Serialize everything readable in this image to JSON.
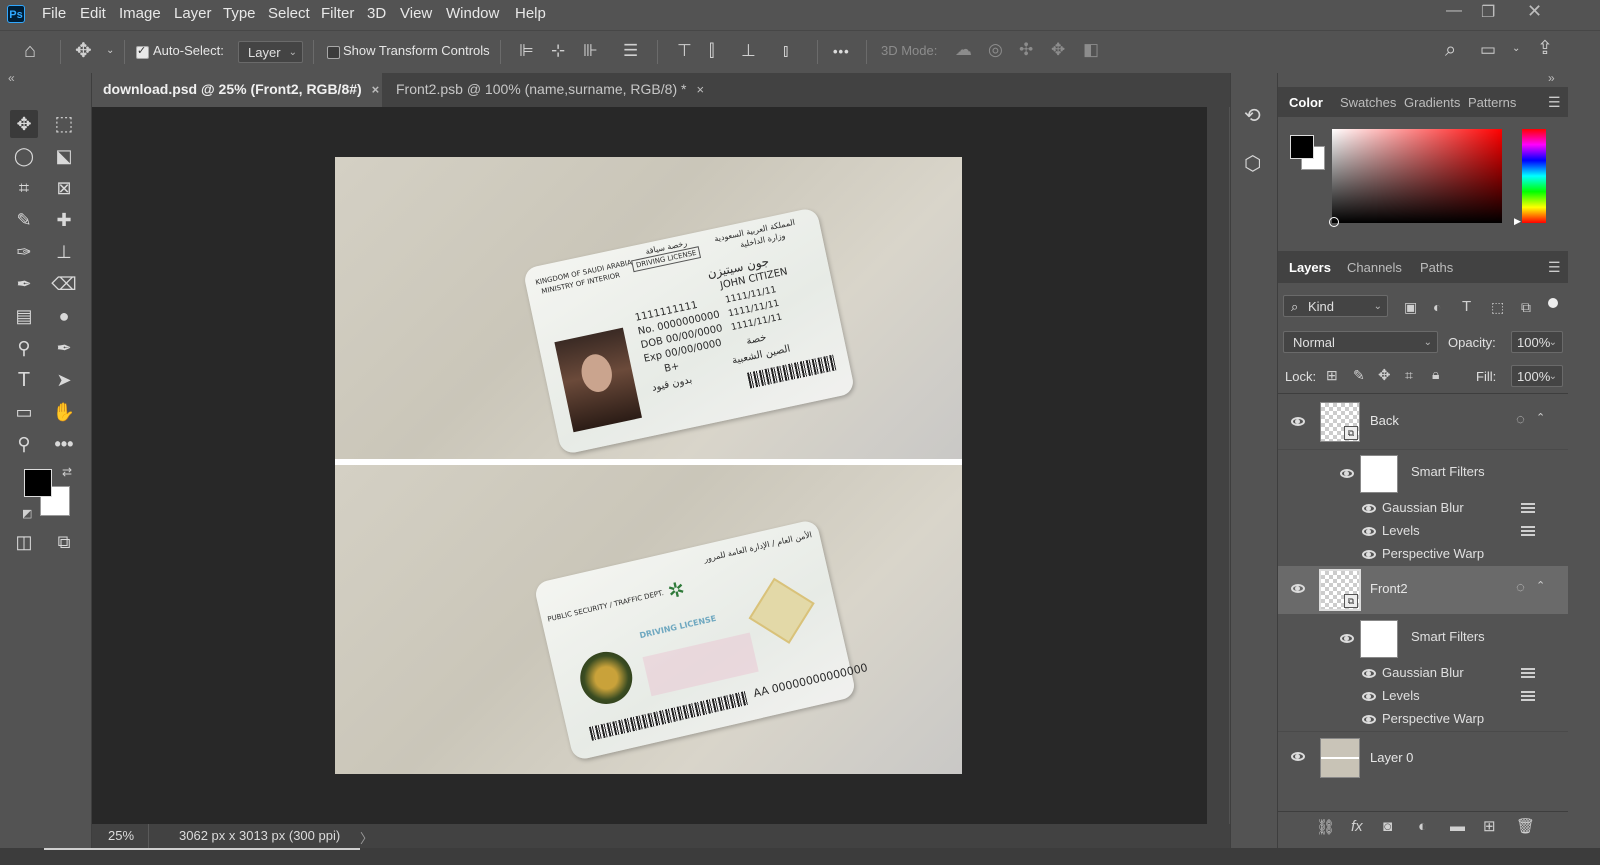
{
  "app": {
    "logo": "Ps"
  },
  "menu": [
    "File",
    "Edit",
    "Image",
    "Layer",
    "Type",
    "Select",
    "Filter",
    "3D",
    "View",
    "Window",
    "Help"
  ],
  "window_controls": {
    "minimize": "—",
    "restore": "❐",
    "close": "✕"
  },
  "options_bar": {
    "auto_select_label": "Auto-Select:",
    "auto_select_checked": true,
    "auto_select_target": "Layer",
    "show_transform_label": "Show Transform Controls",
    "show_transform_checked": false,
    "more_label": "•••",
    "mode_3d_label": "3D Mode:"
  },
  "tabs": [
    {
      "title": "download.psd @ 25% (Front2, RGB/8#)",
      "close": "×",
      "active": true
    },
    {
      "title": "Front2.psb @ 100% (name,surname, RGB/8) *",
      "close": "×",
      "active": false
    }
  ],
  "status": {
    "zoom": "25%",
    "doc_info": "3062 px x 3013 px (300 ppi)",
    "arrow": "〉"
  },
  "card_front": {
    "line1": "KINGDOM OF SAUDI ARABIA",
    "line2": "MINISTRY OF INTERIOR",
    "dl_label": "DRIVING LICENSE",
    "ar_kingdom": "المملكة العربية السعودية",
    "ar_ministry": "وزارة الداخلية",
    "ar_dl": "رخصة سياقة",
    "ar_name": "جون سيتيزن",
    "name": "JOHN CITIZEN",
    "id": "1111111111",
    "no": "No. 0000000000",
    "dob": "DOB  00/00/0000",
    "exp": "Exp  00/00/0000",
    "blood": "B+",
    "dates": "1111/11/11",
    "ar_type": "خصة",
    "ar_nat": "الصين الشعبية",
    "ar_restr": "بدون قيود"
  },
  "card_back": {
    "dept": "PUBLIC SECURITY / TRAFFIC DEPT.",
    "ar_dept": "الأمن العام / الإدارة العامة للمرور",
    "dl": "DRIVING LICENSE",
    "serial": "AA 00000000000000"
  },
  "color_panel": {
    "tabs": [
      "Color",
      "Swatches",
      "Gradients",
      "Patterns"
    ],
    "active": "Color",
    "hue_color": "#ff0000"
  },
  "layers_panel": {
    "tabs": [
      "Layers",
      "Channels",
      "Paths"
    ],
    "active": "Layers",
    "filter_kind": "Kind",
    "blend_mode": "Normal",
    "opacity_label": "Opacity:",
    "opacity": "100%",
    "lock_label": "Lock:",
    "fill_label": "Fill:",
    "fill": "100%",
    "layers": [
      {
        "name": "Back",
        "smart_filters": "Smart Filters",
        "filters": [
          "Gaussian Blur",
          "Levels",
          "Perspective Warp"
        ]
      },
      {
        "name": "Front2",
        "smart_filters": "Smart Filters",
        "filters": [
          "Gaussian Blur",
          "Levels",
          "Perspective Warp"
        ]
      },
      {
        "name": "Layer 0"
      }
    ]
  }
}
